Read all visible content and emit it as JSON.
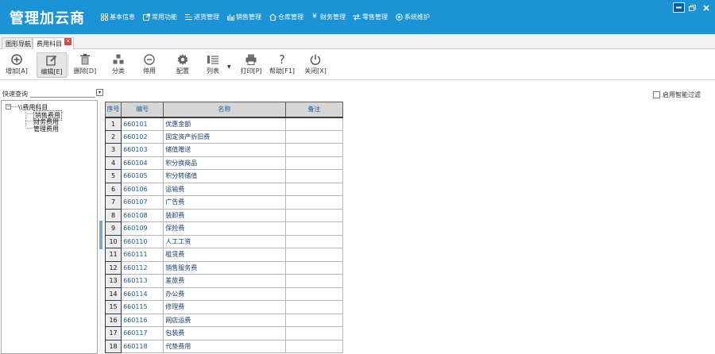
{
  "app": {
    "title": "管理加云商"
  },
  "top_menu": [
    {
      "label": "基本信息",
      "icon": "grid-icon"
    },
    {
      "label": "常用功能",
      "icon": "share-icon"
    },
    {
      "label": "进货管理",
      "icon": "inbound-list-icon"
    },
    {
      "label": "销售管理",
      "icon": "bar-chart-icon"
    },
    {
      "label": "仓库管理",
      "icon": "warehouse-icon"
    },
    {
      "label": "财务管理",
      "icon": "yen-icon"
    },
    {
      "label": "零售管理",
      "icon": "retail-arrows-icon"
    },
    {
      "label": "系统维护",
      "icon": "gear-circle-icon"
    }
  ],
  "tabs": [
    {
      "label": "图形导航"
    },
    {
      "label": "费用科目"
    }
  ],
  "toolbar": [
    {
      "label": "增加[A]",
      "icon": "add-circle-icon"
    },
    {
      "label": "编辑[E]",
      "icon": "edit-icon"
    },
    {
      "label": "删除[D]",
      "icon": "trash-icon"
    },
    {
      "label": "分类",
      "icon": "category-icon"
    },
    {
      "label": "停用",
      "icon": "minus-circle-icon"
    },
    {
      "label": "配置",
      "icon": "gear-icon"
    },
    {
      "label": "列表",
      "icon": "list-icon"
    },
    {
      "label": "打印[P]",
      "icon": "printer-icon"
    },
    {
      "label": "帮助[F1]",
      "icon": "help-icon"
    },
    {
      "label": "关闭[X]",
      "icon": "power-icon"
    }
  ],
  "quick_search": {
    "label": "快速查询",
    "value": "",
    "placeholder": ""
  },
  "smart_filter": {
    "label": "启用智能过滤",
    "checked": false
  },
  "tree": {
    "root": "\\\\费用科目",
    "children": [
      "销售费用",
      "财务费用",
      "管理费用"
    ]
  },
  "grid": {
    "columns": [
      "序号",
      "编号",
      "名称",
      "备注"
    ],
    "rows": [
      {
        "no": "1",
        "code": "660101",
        "name": "优惠金额",
        "remark": ""
      },
      {
        "no": "2",
        "code": "660102",
        "name": "固定资产折旧费",
        "remark": ""
      },
      {
        "no": "3",
        "code": "660103",
        "name": "储值赠送",
        "remark": ""
      },
      {
        "no": "4",
        "code": "660104",
        "name": "积分换商品",
        "remark": ""
      },
      {
        "no": "5",
        "code": "660105",
        "name": "积分转储值",
        "remark": ""
      },
      {
        "no": "6",
        "code": "660106",
        "name": "运输费",
        "remark": ""
      },
      {
        "no": "7",
        "code": "660107",
        "name": "广告费",
        "remark": ""
      },
      {
        "no": "8",
        "code": "660108",
        "name": "装卸费",
        "remark": ""
      },
      {
        "no": "9",
        "code": "660109",
        "name": "保险费",
        "remark": ""
      },
      {
        "no": "10",
        "code": "660110",
        "name": "人工工资",
        "remark": ""
      },
      {
        "no": "11",
        "code": "660111",
        "name": "租赁费",
        "remark": ""
      },
      {
        "no": "12",
        "code": "660112",
        "name": "销售服务费",
        "remark": ""
      },
      {
        "no": "13",
        "code": "660113",
        "name": "差旅费",
        "remark": ""
      },
      {
        "no": "14",
        "code": "660114",
        "name": "办公费",
        "remark": ""
      },
      {
        "no": "15",
        "code": "660115",
        "name": "修理费",
        "remark": ""
      },
      {
        "no": "16",
        "code": "660116",
        "name": "网店运费",
        "remark": ""
      },
      {
        "no": "17",
        "code": "660117",
        "name": "包装费",
        "remark": ""
      },
      {
        "no": "18",
        "code": "660118",
        "name": "代垫费用",
        "remark": ""
      }
    ]
  },
  "colors": {
    "header_blue": "#1b93d5",
    "grid_text_blue": "#1a5b9c",
    "tab_close_red": "#e0433a"
  }
}
